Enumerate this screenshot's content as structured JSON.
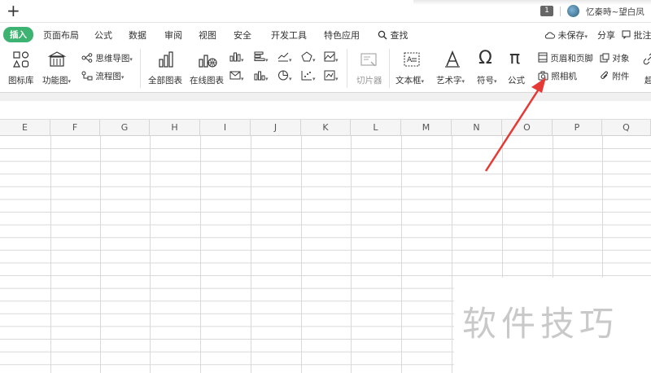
{
  "titlebar": {
    "new_tab": "+",
    "badge": "1",
    "user_name": "忆秦時~望白凤"
  },
  "menu": {
    "items": [
      "插入",
      "页面布局",
      "公式",
      "数据",
      "审阅",
      "视图",
      "安全",
      "开发工具",
      "特色应用"
    ],
    "search_label": "查找",
    "unsaved": "未保存",
    "share": "分享",
    "annotate": "批注"
  },
  "ribbon": {
    "icon_lib": "图标库",
    "func_chart": "功能图",
    "mind_map": "思维导图",
    "flow_chart": "流程图",
    "all_charts": "全部图表",
    "online_charts": "在线图表",
    "slicer": "切片器",
    "text_box": "文本框",
    "art_text": "艺术字",
    "symbol": "符号",
    "formula": "公式",
    "header_footer": "页眉和页脚",
    "object": "对象",
    "camera": "照相机",
    "attachment": "附件",
    "more": "超"
  },
  "columns": [
    "E",
    "F",
    "G",
    "H",
    "I",
    "J",
    "K",
    "L",
    "M",
    "N",
    "O",
    "P",
    "Q"
  ],
  "watermark": "软件技巧",
  "colors": {
    "accent_green": "#3cb371",
    "arrow_red": "#e53935",
    "grid_line": "#d9d9d9"
  }
}
